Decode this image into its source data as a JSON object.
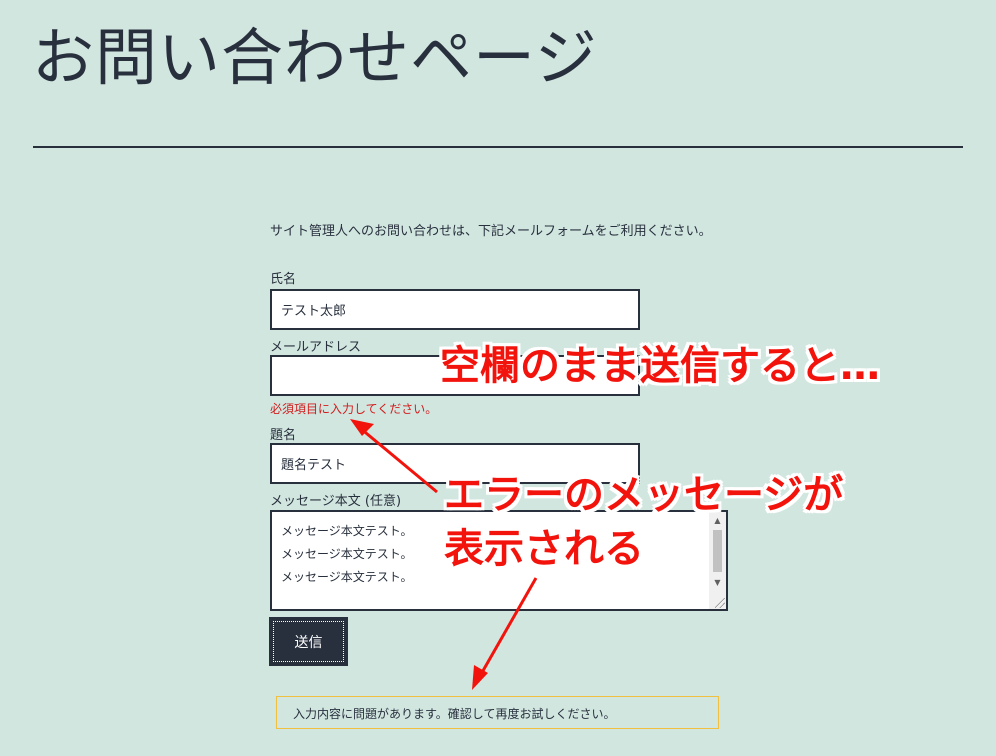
{
  "page": {
    "title": "お問い合わせページ",
    "intro": "サイト管理人へのお問い合わせは、下記メールフォームをご利用ください。"
  },
  "form": {
    "name_label": "氏名",
    "name_value": "テスト太郎",
    "email_label": "メールアドレス",
    "email_value": "",
    "email_error": "必須項目に入力してください。",
    "subject_label": "題名",
    "subject_value": "題名テスト",
    "message_label": "メッセージ本文 (任意)",
    "message_value": "メッセージ本文テスト。\nメッセージ本文テスト。\nメッセージ本文テスト。",
    "submit_label": "送信",
    "response_message": "入力内容に問題があります。確認して再度お試しください。"
  },
  "annotations": {
    "callout_1": "空欄のまま送信すると…",
    "callout_2_line1": "エラーのメッセージが",
    "callout_2_line2": "表示される",
    "color": "#f2140c"
  },
  "colors": {
    "background": "#d2e6e0",
    "text": "#28303d",
    "error": "#d11c1c",
    "response_border": "#f0c040"
  },
  "icons": {
    "scroll_up": "scroll-up-arrow-icon",
    "scroll_down": "scroll-down-arrow-icon",
    "resize": "resize-grip-icon"
  }
}
